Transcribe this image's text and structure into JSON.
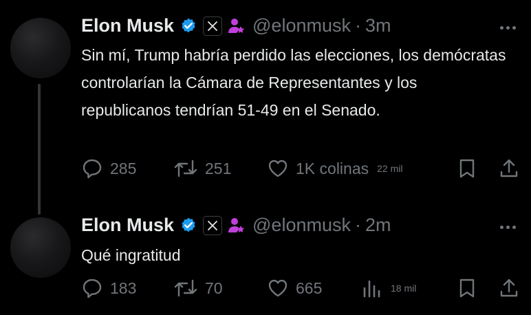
{
  "tweets": [
    {
      "author": {
        "name": "Elon Musk",
        "handle": "@elonmusk"
      },
      "time": "3m",
      "text": "Sin mí, Trump habría perdido las elecciones, los demócratas controlarían la Cámara de Representantes y los republicanos tendrían 51-49 en el Senado.",
      "replies": "285",
      "reposts": "251",
      "likes": "1K colinas",
      "views": "22 mil"
    },
    {
      "author": {
        "name": "Elon Musk",
        "handle": "@elonmusk"
      },
      "time": "2m",
      "text": "Qué ingratitud",
      "replies": "183",
      "reposts": "70",
      "likes": "665",
      "views": "18 mil"
    }
  ],
  "separator": "·",
  "colors": {
    "background": "#000000",
    "text": "#e7e9ea",
    "muted": "#71767b",
    "verified": "#1d9bf0",
    "affiliate": "#c03fdb"
  },
  "icons": [
    "verified-badge-icon",
    "x-logo-icon",
    "affiliate-person-icon",
    "more-dots-icon",
    "reply-icon",
    "repost-icon",
    "like-icon",
    "views-icon",
    "bookmark-icon",
    "share-icon"
  ]
}
